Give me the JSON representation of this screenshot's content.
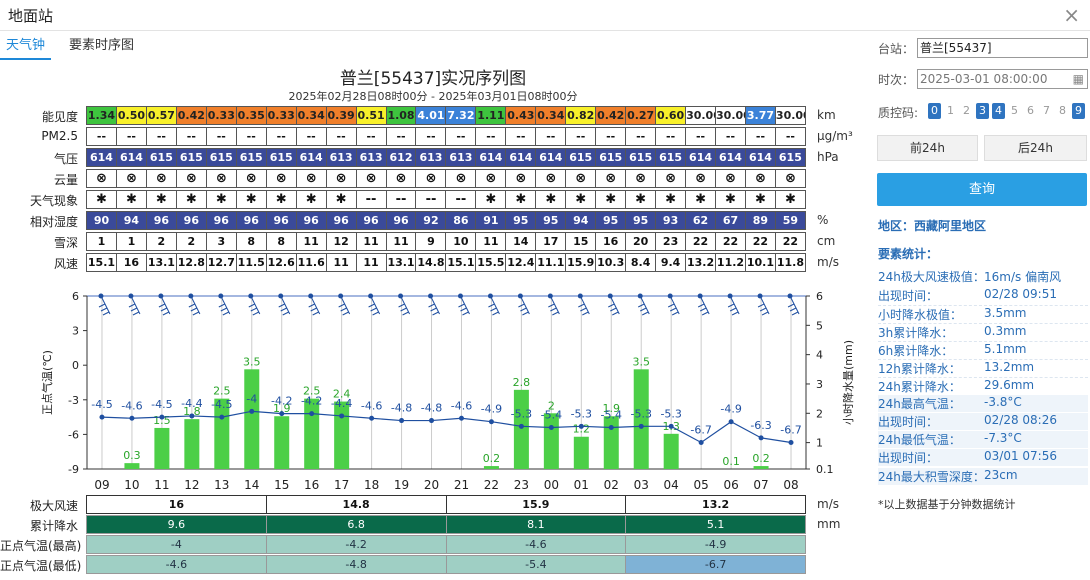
{
  "window": {
    "title": "地面站",
    "close": "×"
  },
  "tabs": [
    {
      "label": "天气钟"
    },
    {
      "label": "要素时序图"
    }
  ],
  "chart_data": {
    "type": "line",
    "title": "普兰[55437]实况序列图",
    "subtitle": "2025年02月28日08时00分 - 2025年03月01日08时00分",
    "hours": [
      "09",
      "10",
      "11",
      "12",
      "13",
      "14",
      "15",
      "16",
      "17",
      "18",
      "19",
      "20",
      "21",
      "22",
      "23",
      "00",
      "01",
      "02",
      "03",
      "04",
      "05",
      "06",
      "07",
      "08"
    ],
    "table_rows": [
      {
        "label": "能见度",
        "unit": "km",
        "values": [
          "1.34",
          "0.50",
          "0.57",
          "0.42",
          "0.33",
          "0.35",
          "0.33",
          "0.34",
          "0.39",
          "0.51",
          "1.08",
          "4.01",
          "7.32",
          "1.11",
          "0.43",
          "0.34",
          "0.82",
          "0.42",
          "0.27",
          "0.60",
          "30.00",
          "30.00",
          "3.77",
          "30.00"
        ]
      },
      {
        "label": "PM2.5",
        "unit": "μg/m³",
        "values": [
          "--",
          "--",
          "--",
          "--",
          "--",
          "--",
          "--",
          "--",
          "--",
          "--",
          "--",
          "--",
          "--",
          "--",
          "--",
          "--",
          "--",
          "--",
          "--",
          "--",
          "--",
          "--",
          "--",
          "--"
        ]
      },
      {
        "label": "气压",
        "unit": "hPa",
        "values": [
          "614",
          "614",
          "615",
          "615",
          "615",
          "615",
          "615",
          "614",
          "613",
          "613",
          "612",
          "613",
          "613",
          "614",
          "614",
          "614",
          "615",
          "615",
          "615",
          "615",
          "614",
          "614",
          "614",
          "615"
        ]
      },
      {
        "label": "云量",
        "unit": "",
        "values": [
          "⊗",
          "⊗",
          "⊗",
          "⊗",
          "⊗",
          "⊗",
          "⊗",
          "⊗",
          "⊗",
          "⊗",
          "⊗",
          "⊗",
          "⊗",
          "⊗",
          "⊗",
          "⊗",
          "⊗",
          "⊗",
          "⊗",
          "⊗",
          "⊗",
          "⊗",
          "⊗",
          "⊗"
        ]
      },
      {
        "label": "天气现象",
        "unit": "",
        "values": [
          "✱",
          "✱",
          "✱",
          "✱",
          "✱",
          "✱",
          "✱",
          "✱",
          "✱",
          "--",
          "--",
          "--",
          "--",
          "✱",
          "✱",
          "✱",
          "✱",
          "✱",
          "✱",
          "✱",
          "✱",
          "✱",
          "✱",
          "✱"
        ]
      },
      {
        "label": "相对湿度",
        "unit": "%",
        "values": [
          "90",
          "94",
          "96",
          "96",
          "96",
          "96",
          "96",
          "96",
          "96",
          "96",
          "96",
          "92",
          "86",
          "91",
          "95",
          "95",
          "94",
          "95",
          "95",
          "93",
          "62",
          "67",
          "89",
          "59"
        ]
      },
      {
        "label": "雪深",
        "unit": "cm",
        "values": [
          "1",
          "1",
          "2",
          "2",
          "3",
          "8",
          "8",
          "11",
          "12",
          "11",
          "11",
          "9",
          "10",
          "11",
          "14",
          "17",
          "15",
          "16",
          "20",
          "23",
          "22",
          "22",
          "22",
          "22"
        ]
      },
      {
        "label": "风速",
        "unit": "m/s",
        "values": [
          "15.1",
          "16",
          "13.1",
          "12.8",
          "12.7",
          "11.5",
          "12.6",
          "11.6",
          "11",
          "11",
          "13.1",
          "14.8",
          "15.1",
          "15.5",
          "12.4",
          "11.1",
          "15.9",
          "10.3",
          "8.4",
          "9.4",
          "13.2",
          "11.2",
          "10.1",
          "11.8"
        ]
      }
    ],
    "temperature": {
      "ylabel": "正点气温(℃)",
      "ylim": [
        -9,
        6
      ],
      "yticks": [
        "6",
        "3",
        "0",
        "-3",
        "-6",
        "-9"
      ],
      "values": [
        -4.5,
        -4.6,
        -4.5,
        -4.4,
        -4.5,
        -4,
        -4.2,
        -4.2,
        -4.4,
        -4.6,
        -4.8,
        -4.8,
        -4.6,
        -4.9,
        -5.3,
        -5.4,
        -5.3,
        -5.4,
        -5.3,
        -5.3,
        -6.7,
        -4.9,
        -6.3,
        -6.7
      ]
    },
    "precipitation": {
      "ylabel": "小时降水量(mm)",
      "ylim": [
        0.1,
        6
      ],
      "yticks": [
        "6",
        "5",
        "4",
        "3",
        "2",
        "1",
        "0.1"
      ],
      "values": [
        0,
        0.3,
        1.5,
        1.8,
        2.5,
        3.5,
        1.9,
        2.5,
        2.4,
        0,
        0,
        0,
        0,
        0.2,
        2.8,
        2,
        1.2,
        1.9,
        3.5,
        1.3,
        0,
        0.1,
        0.2,
        0
      ]
    },
    "precip_labels": [
      "",
      "0.3",
      "1.5",
      "1.8",
      "2.5",
      "3.5",
      "1.9",
      "2.5",
      "2.4",
      "",
      "",
      "",
      "",
      "0.2",
      "2.8",
      "2",
      "1.2",
      "1.9",
      "3.5",
      "1.3",
      "",
      "0.1",
      "0.2",
      ""
    ],
    "wind_barb_rows": 2,
    "summary_rows": [
      {
        "label": "极大风速",
        "unit": "m/s",
        "values": [
          "16",
          "14.8",
          "15.9",
          "13.2"
        ]
      },
      {
        "label": "累计降水",
        "unit": "mm",
        "values": [
          "9.6",
          "6.8",
          "8.1",
          "5.1"
        ]
      },
      {
        "label": "正点气温(最高)",
        "unit": "",
        "values": [
          "-4",
          "-4.2",
          "-4.6",
          "-4.9"
        ]
      },
      {
        "label": "正点气温(最低)",
        "unit": "",
        "values": [
          "-4.6",
          "-4.8",
          "-5.4",
          "-6.7"
        ]
      }
    ],
    "colors": {
      "vis_green": "#3ec43e",
      "vis_orange": "#f07f2a",
      "vis_yellow": "#f8f02a",
      "vis_blue": "#3b82d8",
      "vis_white": "#ffffff",
      "bar": "#4ccf47",
      "line": "#1f4fa0",
      "table_blue": "#3a4a9a",
      "summary_dark": "#0a6a4a",
      "summary_light": "#9fcfc4"
    }
  },
  "side": {
    "station_label": "台站：",
    "station_value": "普兰[55437]",
    "time_label": "时次：",
    "time_value": "2025-03-01 08:00:00",
    "qc_label": "质控码:",
    "qc_codes": [
      "0",
      "1",
      "2",
      "3",
      "4",
      "5",
      "6",
      "7",
      "8",
      "9"
    ],
    "prev_btn": "前24h",
    "next_btn": "后24h",
    "query_btn": "查询",
    "region": "地区：西藏阿里地区",
    "stats_head": "要素统计：",
    "stats": [
      {
        "label": "24h极大风速极值：",
        "value": "16m/s 偏南风"
      },
      {
        "label": "出现时间：",
        "value": "02/28 09:51"
      },
      {
        "label": "小时降水极值：",
        "value": "3.5mm"
      },
      {
        "label": "3h累计降水：",
        "value": "0.3mm"
      },
      {
        "label": "6h累计降水：",
        "value": "5.1mm"
      },
      {
        "label": "12h累计降水：",
        "value": "13.2mm"
      },
      {
        "label": "24h累计降水：",
        "value": "29.6mm"
      },
      {
        "label": "24h最高气温：",
        "value": "-3.8°C"
      },
      {
        "label": "出现时间：",
        "value": "02/28 08:26"
      },
      {
        "label": "24h最低气温：",
        "value": "-7.3°C"
      },
      {
        "label": "出现时间：",
        "value": "03/01 07:56"
      },
      {
        "label": "24h最大积雪深度：",
        "value": "23cm"
      }
    ],
    "note": "*以上数据基于分钟数据统计"
  }
}
